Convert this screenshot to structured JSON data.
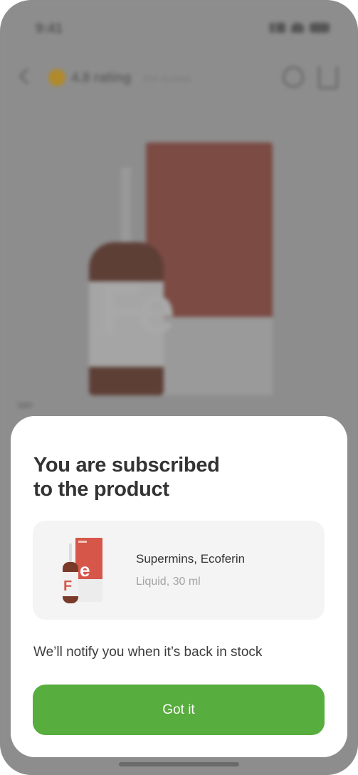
{
  "status_bar": {
    "time": "9:41"
  },
  "app_header": {
    "rating": "4.8 rating",
    "reviews": "154 reviews"
  },
  "hero": {
    "image_letters": "Fe"
  },
  "sheet": {
    "title_line1": "You are subscribed",
    "title_line2": "to the product",
    "product": {
      "name": "Supermins, Ecoferin",
      "variant": "Liquid, 30 ml"
    },
    "notify_text": "We’ll notify you when it’s back in stock",
    "button_label": "Got it"
  },
  "colors": {
    "accent": "#57ad3d",
    "title": "#333333",
    "muted": "#a4a4a4",
    "card_bg": "#f4f4f4",
    "overlay": "#8d8d8d"
  },
  "icons": [
    "back-icon",
    "star-icon",
    "heart-icon",
    "share-icon",
    "signal-icon",
    "wifi-icon",
    "battery-icon"
  ]
}
